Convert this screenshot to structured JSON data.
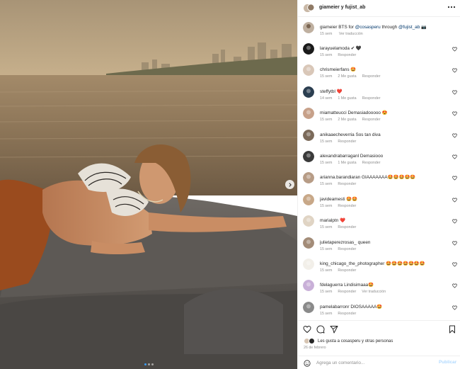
{
  "post": {
    "author_line": "giameier y fujist_ab",
    "caption": {
      "user": "giameier",
      "text_before": "BTS for",
      "mention1": "@cosasperu",
      "text_mid": "through",
      "mention2": "@fujist_ab",
      "emoji": "📷",
      "time": "15 sem",
      "translate": "Ver traducción"
    }
  },
  "comments": [
    {
      "user": "larayuelamoda",
      "text": "✔ 🖤",
      "time": "15 sem",
      "likes": "",
      "reply": "Responder",
      "translate": ""
    },
    {
      "user": "chrismeierfans",
      "text": "🤩",
      "time": "15 sem",
      "likes": "2 Me gusta",
      "reply": "Responder",
      "translate": ""
    },
    {
      "user": "steffytbl",
      "text": "❤️",
      "time": "14 sem",
      "likes": "1 Me gusta",
      "reply": "Responder",
      "translate": ""
    },
    {
      "user": "miamatteucci",
      "text": "Demasiadooooo 😍",
      "time": "15 sem",
      "likes": "2 Me gusta",
      "reply": "Responder",
      "translate": ""
    },
    {
      "user": "anikaaecheverria",
      "text": "Sos tan diva",
      "time": "15 sem",
      "likes": "",
      "reply": "Responder",
      "translate": ""
    },
    {
      "user": "alexandrabarraganl",
      "text": "Demasiooo",
      "time": "15 sem",
      "likes": "1 Me gusta",
      "reply": "Responder",
      "translate": ""
    },
    {
      "user": "arianna.barandiaran",
      "text": "GIAAAAAAA🤩🤩🤩🤩🤩",
      "time": "15 sem",
      "likes": "",
      "reply": "Responder",
      "translate": ""
    },
    {
      "user": "javideamesti",
      "text": "🤩🤩",
      "time": "15 sem",
      "likes": "",
      "reply": "Responder",
      "translate": ""
    },
    {
      "user": "marialptn",
      "text": "❤️",
      "time": "15 sem",
      "likes": "",
      "reply": "Responder",
      "translate": ""
    },
    {
      "user": "julietaperezrosas_",
      "text": "queen",
      "time": "15 sem",
      "likes": "",
      "reply": "Responder",
      "translate": ""
    },
    {
      "user": "king_chicago_the_photographer",
      "text": "🤩🤩🤩🤩🤩🤩🤩",
      "time": "15 sem",
      "likes": "",
      "reply": "Responder",
      "translate": ""
    },
    {
      "user": "fdelaguerra",
      "text": "Lindisimaaa🤩",
      "time": "15 sem",
      "likes": "",
      "reply": "Responder",
      "translate": "Ver traducción"
    },
    {
      "user": "pamelabarronr",
      "text": "DIOSAAAAA🤩",
      "time": "15 sem",
      "likes": "",
      "reply": "Responder",
      "translate": ""
    }
  ],
  "actions": {
    "likes_text": "Les gusta a cosasperu y otras personas",
    "date": "26 de febrero"
  },
  "add_comment": {
    "placeholder": "Agrega un comentario...",
    "publish": "Publicar"
  },
  "colors": {
    "accent": "#0095f6",
    "meta_gray": "#8e8e8e",
    "verified": "#3897f0"
  }
}
